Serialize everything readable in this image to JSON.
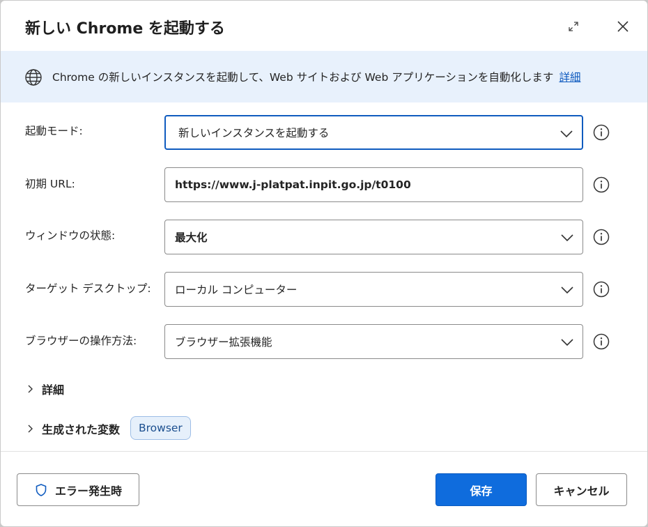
{
  "dialog": {
    "title": "新しい Chrome を起動する"
  },
  "banner": {
    "icon": "globe-icon",
    "text": "Chrome の新しいインスタンスを起動して、Web サイトおよび Web アプリケーションを自動化します",
    "link": "詳細"
  },
  "form": {
    "launch_mode": {
      "label": "起動モード:",
      "value": "新しいインスタンスを起動する"
    },
    "initial_url": {
      "label": "初期 URL:",
      "value": "https://www.j-platpat.inpit.go.jp/t0100"
    },
    "window_state": {
      "label": "ウィンドウの状態:",
      "value": "最大化"
    },
    "target_desktop": {
      "label": "ターゲット デスクトップ:",
      "value": "ローカル コンピューター"
    },
    "browser_method": {
      "label": "ブラウザーの操作方法:",
      "value": "ブラウザー拡張機能"
    }
  },
  "sections": {
    "details": "詳細",
    "generated_vars": "生成された変数",
    "var_badge": "Browser"
  },
  "footer": {
    "on_error": "エラー発生時",
    "save": "保存",
    "cancel": "キャンセル"
  },
  "colors": {
    "accent": "#0f6cdd",
    "banner_bg": "#e8f1fc",
    "link": "#0f5bbf"
  }
}
